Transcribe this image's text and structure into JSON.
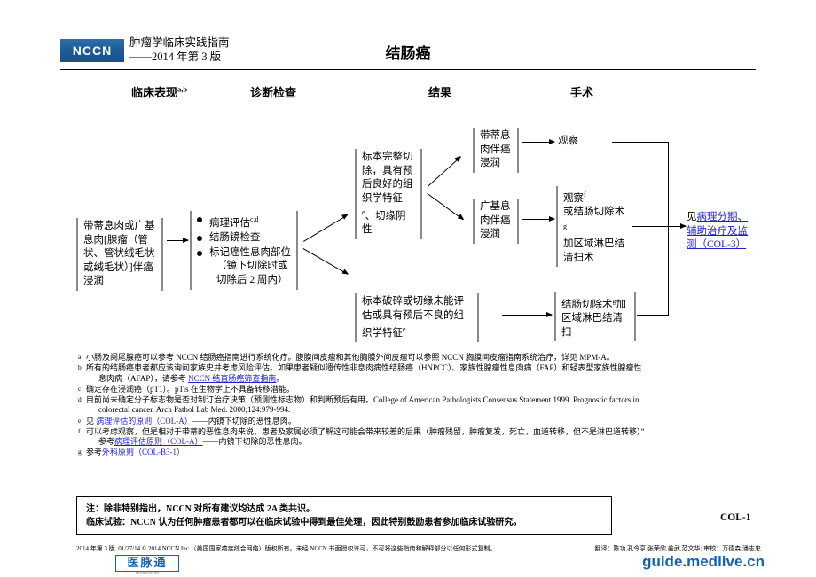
{
  "header": {
    "logo_text": "NCCN",
    "subtitle_line1": "肿瘤学临床实践指南",
    "subtitle_line2": "——2014 年第 3 版",
    "title": "结肠癌"
  },
  "columns": [
    {
      "label": "临床表现",
      "sup": "a,b"
    },
    {
      "label": "诊断检查",
      "sup": ""
    },
    {
      "label": "结果",
      "sup": ""
    },
    {
      "label": "手术",
      "sup": ""
    }
  ],
  "flow": {
    "presentation": "带蒂息肉或广基息肉[腺瘤（管状、管状绒毛状或绒毛状）]伴癌浸润",
    "workup": [
      {
        "text": "病理评估",
        "sup": "c,d",
        "cont": ""
      },
      {
        "text": "结肠镜检查",
        "sup": "",
        "cont": ""
      },
      {
        "text": "标记癌性息肉部位",
        "sup": "",
        "cont": "（镜下切除时或切除后 2 周内）"
      }
    ],
    "finding_top": "标本完整切除，具有预后良好的组织学特征 e、切缘阴性",
    "finding_top_main": "标本完整切除，具有预后良好的组织学特征",
    "finding_top_sup": "e",
    "finding_top_tail": "、切缘阴性",
    "finding_bottom_main": "标本破碎或切缘未能评估或具有预后不良的组织学特征",
    "finding_bottom_sup": "e",
    "sub_finding_1": "带蒂息肉伴癌浸润",
    "sub_finding_2": "广基息肉伴癌浸润",
    "surgery_1": "观察",
    "surgery_2_l1": "观察",
    "surgery_2_l1_sup": "f",
    "surgery_2_l2": "或结肠切除术",
    "surgery_2_l2_sup": "g",
    "surgery_2_l3": "加区域淋巴结清扫术",
    "surgery_3_l1": "结肠切除术",
    "surgery_3_l1_sup": "g",
    "surgery_3_l2": "加区域淋巴结清扫"
  },
  "outcome_link": {
    "prefix": "见",
    "link_text": "病理分期、辅助治疗及监测（COL-3）"
  },
  "footnotes": [
    {
      "mark": "a",
      "text": "小肠及阑尾腺癌可以参考 NCCN 结肠癌指南进行系统化疗。腹膜间皮瘤和其他胸膜外间皮瘤可以参照 NCCN 胸膜间皮瘤指南系统治疗，详见 MPM-A。",
      "indent": "",
      "link": "",
      "indent_suffix": ""
    },
    {
      "mark": "b",
      "text": "所有的结肠癌患者都应该询问家族史并考虑风险评估。如果患者疑似遗传性非息肉病性结肠癌（HNPCC）、家族性腺瘤性息肉病（FAP）和轻表型家族性腺瘤性",
      "indent": "息肉病（AFAP），请参考 ",
      "link": "NCCN 结直肠癌筛查指南",
      "indent_suffix": "。"
    },
    {
      "mark": "c",
      "text": "确定存在浸润癌（pT1）。pTis 在生物学上不具备转移潜能。",
      "indent": "",
      "link": "",
      "indent_suffix": ""
    },
    {
      "mark": "d",
      "text": "目前尚未确定分子标志物是否对制订治疗决策（预测性标志物）和判断预后有用。College of American Pathologists Consensus Statement 1999. Prognostic factors in",
      "indent": "colorectal cancer. Arch Pathol Lab Med. 2000;124:979-994.",
      "link": "",
      "indent_suffix": ""
    },
    {
      "mark": "e",
      "text": "见 ",
      "indent": "",
      "link": "病理评估的原则（COL-A）",
      "indent_suffix": "——内镜下切除的恶性息肉。"
    },
    {
      "mark": "f",
      "text": "可以考虑观察，但是相对于带蒂的恶性息肉来说，患者及家属必须了解这可能会带来较差的后果（肿瘤残留，肿瘤复发，死亡，血道转移，但不是淋巴道转移）”",
      "indent": "参考",
      "link": "病理评估原则（COL-A）",
      "indent_suffix": "——内镜下切除的恶性息肉。"
    },
    {
      "mark": "g",
      "text": "参考",
      "indent": "",
      "link": "外科原则（COL-B3-1）",
      "indent_suffix": ""
    }
  ],
  "note_box": {
    "line1": "注：除非特别指出，NCCN 对所有建议均达成 2A 类共识。",
    "line2": "临床试验：NCCN 认为任何肿瘤患者都可以在临床试验中得到最佳处理，因此特别鼓励患者参加临床试验研究。"
  },
  "page_id": "COL-1",
  "footer": {
    "copyright": "2014 年第 3 版, 01/27/14 © 2014 NCCN Inc.（美国国家癌症综合网络）版权所有。未经 NCCN 书面授权许可，不可将这些指南和解释部分以任何形式复制。",
    "credits_line1": "翻译：陈功,孔令亨,张荣欣,姜武,范文华; 审校：万德森,潘志忠",
    "brand_cn": "医脉通",
    "brand_cn_sub": "medlive.cn",
    "brand_url": "guide.medlive.cn"
  }
}
